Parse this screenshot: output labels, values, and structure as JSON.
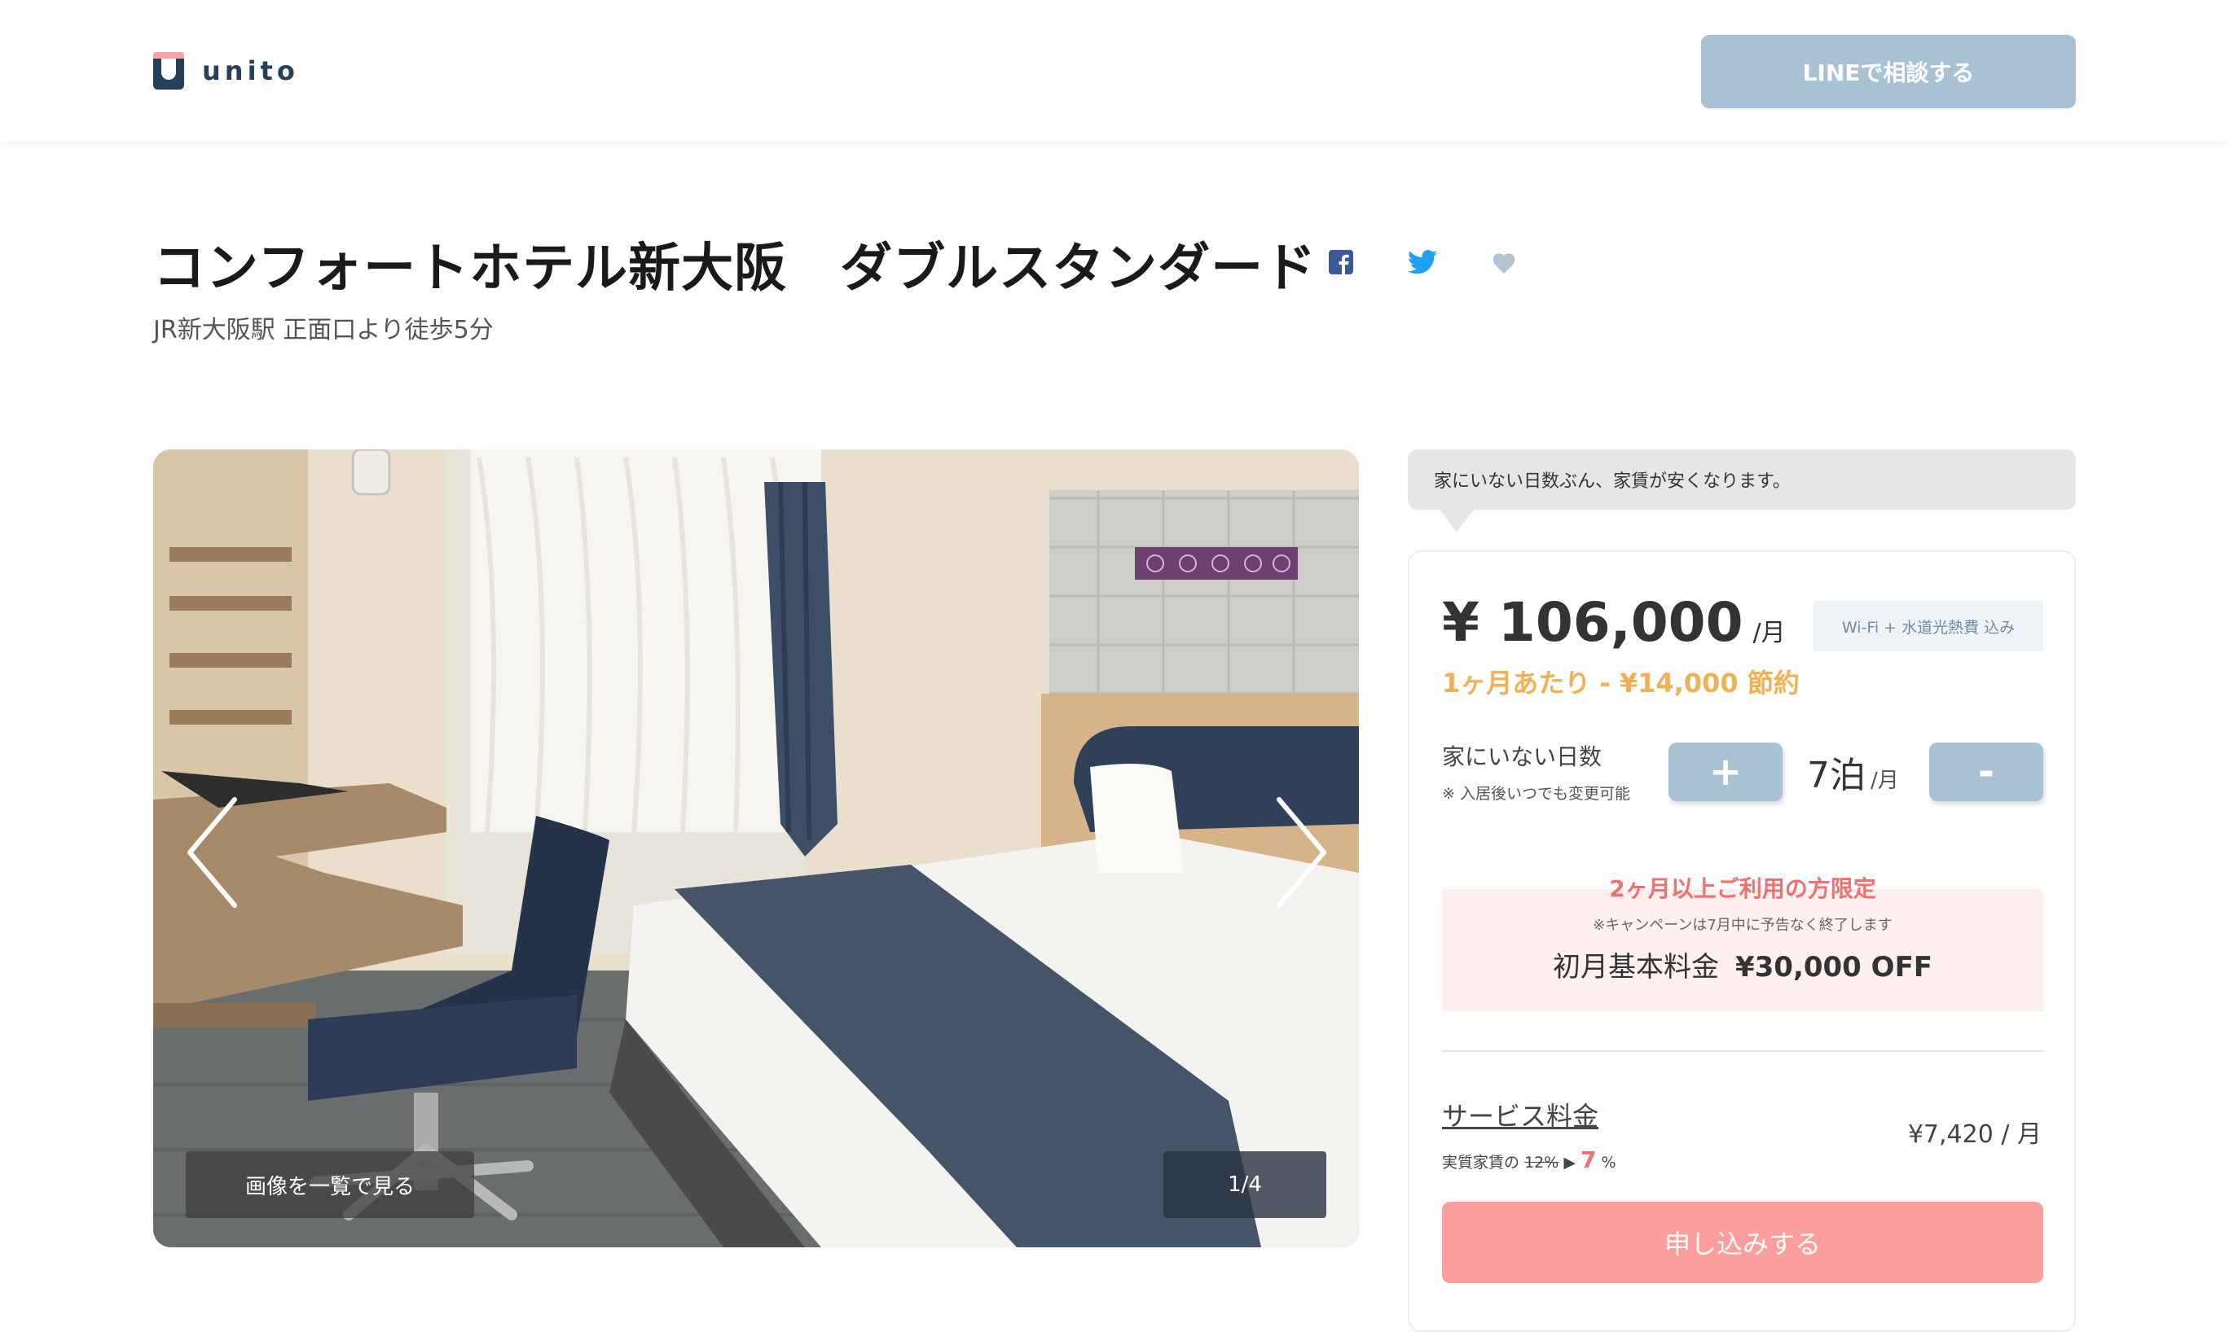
{
  "header": {
    "logo_text": "unito",
    "line_button": "LINEで相談する"
  },
  "listing": {
    "title": "コンフォートホテル新大阪　ダブルスタンダード",
    "access": "JR新大阪駅 正面口より徒歩5分"
  },
  "share": {
    "facebook_icon": "facebook-icon",
    "twitter_icon": "twitter-icon",
    "favorite_icon": "heart-icon"
  },
  "gallery": {
    "view_all_label": "画像を一覧で見る",
    "counter": "1/4",
    "prev_icon": "chevron-left-icon",
    "next_icon": "chevron-right-icon"
  },
  "pricing": {
    "banner": "家にいない日数ぶん、家賃が安くなります。",
    "price": "¥ 106,000",
    "price_unit": "/月",
    "included_badge": "Wi-Fi + 水道光熱費 込み",
    "savings": "1ヶ月あたり - ¥14,000 節約",
    "away_days_label": "家にいない日数",
    "away_days_note": "※ 入居後いつでも変更可能",
    "plus_label": "+",
    "minus_label": "-",
    "nights_value": "7泊",
    "nights_unit": "/月"
  },
  "campaign": {
    "heading": "2ヶ月以上ご利用の方限定",
    "note": "※キャンペーンは7月中に予告なく終了します",
    "offer_label": "初月基本料金",
    "offer_value": "¥30,000 OFF"
  },
  "service_fee": {
    "label": "サービス料金",
    "price": "¥7,420 / 月",
    "note_prefix": "実質家賃の",
    "old_rate": "12%",
    "arrow": "▶",
    "new_rate": "7",
    "percent": "%"
  },
  "apply_button": "申し込みする",
  "colors": {
    "accent_blue": "#a9c2d3",
    "accent_pink": "#fc9e9e",
    "savings_orange": "#f0b054",
    "campaign_red": "#f07070",
    "brand_navy": "#24405a"
  }
}
